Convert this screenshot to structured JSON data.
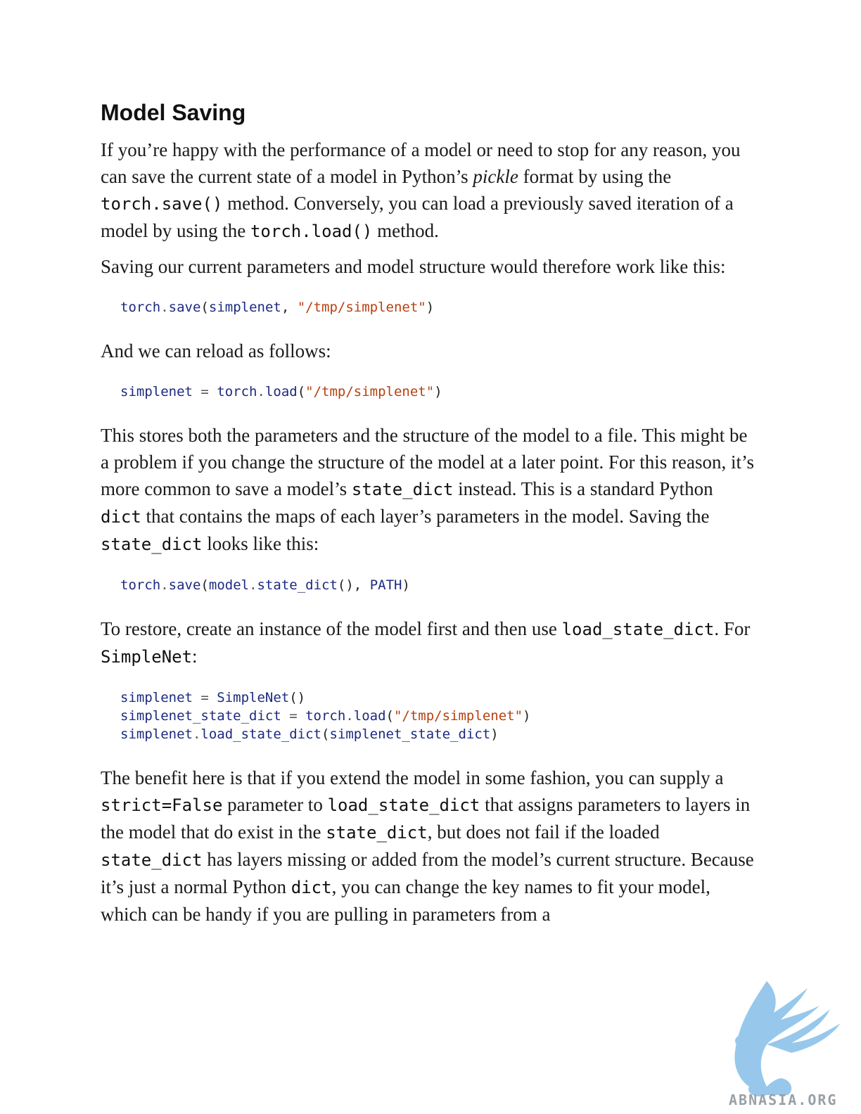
{
  "heading": "Model Saving",
  "p1": {
    "t1": "If you’re happy with the performance of a model or need to stop for any reason, you can save the current state of a model in Python’s ",
    "em": "pickle",
    "t2": " format by using the ",
    "c1": "torch.save()",
    "t3": " method. Conversely, you can load a previously saved iteration of a model by using the ",
    "c2": "torch.load()",
    "t4": " method."
  },
  "p2": "Saving our current parameters and model structure would therefore work like this:",
  "code1": {
    "a": "torch",
    "b": ".",
    "c": "save",
    "d": "(",
    "e": "simplenet",
    "f": ", ",
    "g": "\"/tmp/simplenet\"",
    "h": ")"
  },
  "p3": "And we can reload as follows:",
  "code2": {
    "a": "simplenet",
    "b": " = ",
    "c": "torch",
    "d": ".",
    "e": "load",
    "f": "(",
    "g": "\"/tmp/simplenet\"",
    "h": ")"
  },
  "p4": {
    "t1": "This stores both the parameters and the structure of the model to a file. This might be a problem if you change the structure of the model at a later point. For this reason, it’s more common to save a model’s ",
    "c1": "state_dict",
    "t2": " instead. This is a standard Python ",
    "c2": "dict",
    "t3": " that contains the maps of each layer’s parameters in the model. Saving the ",
    "c3": "state_dict",
    "t4": " looks like this:"
  },
  "code3": {
    "a": "torch",
    "b": ".",
    "c": "save",
    "d": "(",
    "e": "model",
    "f": ".",
    "g": "state_dict",
    "h": "(), ",
    "i": "PATH",
    "j": ")"
  },
  "p5": {
    "t1": "To restore, create an instance of the model first and then use ",
    "c1": "load_state_dict",
    "t2": ". For ",
    "c2": "SimpleNet",
    "t3": ":"
  },
  "code4": {
    "l1": {
      "a": "simplenet",
      "b": " = ",
      "c": "SimpleNet",
      "d": "()"
    },
    "l2": {
      "a": "simplenet_state_dict",
      "b": " = ",
      "c": "torch",
      "d": ".",
      "e": "load",
      "f": "(",
      "g": "\"/tmp/simplenet\"",
      "h": ")"
    },
    "l3": {
      "a": "simplenet",
      "b": ".",
      "c": "load_state_dict",
      "d": "(",
      "e": "simplenet_state_dict",
      "f": ")"
    }
  },
  "p6": {
    "t1": "The benefit here is that if you extend the model in some fashion, you can supply a ",
    "c1": "strict=False",
    "t2": " parameter to ",
    "c2": "load_state_dict",
    "t3": " that assigns parameters to layers in the model that do exist in the ",
    "c3": "state_dict",
    "t4": ", but does not fail if the loaded ",
    "c4": "state_dict",
    "t5": " has layers missing or added from the model’s current structure. Because it’s just a normal Python ",
    "c5": "dict",
    "t6": ", you can change the key names to fit your model, which can be handy if you are pulling in parameters from a"
  },
  "watermark": {
    "text": "ABNASIA.ORG",
    "logo_icon": "griffin-logo-icon",
    "color": "#7fb8e0"
  }
}
